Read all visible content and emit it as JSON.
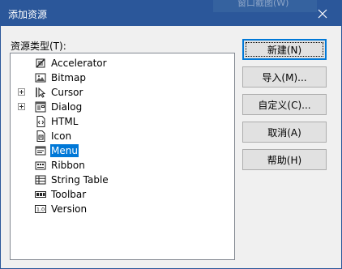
{
  "window": {
    "title": "添加资源",
    "background_ghost_text": "窗口截图(W)",
    "accent_color": "#2b579a"
  },
  "resource_list": {
    "label": "资源类型(T):",
    "items": [
      {
        "label": "Accelerator",
        "icon": "accelerator-icon",
        "expandable": false,
        "selected": false
      },
      {
        "label": "Bitmap",
        "icon": "bitmap-icon",
        "expandable": false,
        "selected": false
      },
      {
        "label": "Cursor",
        "icon": "cursor-icon",
        "expandable": true,
        "selected": false
      },
      {
        "label": "Dialog",
        "icon": "dialog-icon",
        "expandable": true,
        "selected": false
      },
      {
        "label": "HTML",
        "icon": "html-icon",
        "expandable": false,
        "selected": false
      },
      {
        "label": "Icon",
        "icon": "icon-resource-icon",
        "expandable": false,
        "selected": false
      },
      {
        "label": "Menu",
        "icon": "menu-icon",
        "expandable": false,
        "selected": true
      },
      {
        "label": "Ribbon",
        "icon": "ribbon-icon",
        "expandable": false,
        "selected": false
      },
      {
        "label": "String Table",
        "icon": "string-table-icon",
        "expandable": false,
        "selected": false
      },
      {
        "label": "Toolbar",
        "icon": "toolbar-icon",
        "expandable": false,
        "selected": false
      },
      {
        "label": "Version",
        "icon": "version-icon",
        "expandable": false,
        "selected": false
      }
    ],
    "selection_color": "#0078d7"
  },
  "buttons": {
    "new": "新建(N)",
    "import": "导入(M)...",
    "custom": "自定义(C)...",
    "cancel": "取消(A)",
    "help": "帮助(H)"
  }
}
